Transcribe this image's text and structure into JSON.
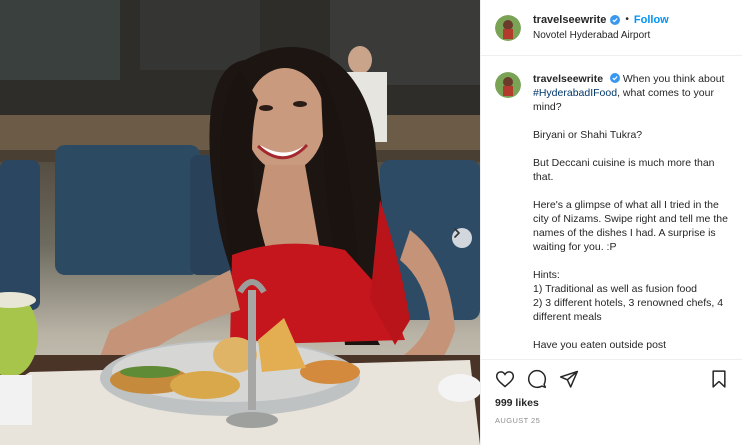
{
  "post": {
    "username": "travelseewrite",
    "follow_label": "Follow",
    "separator": "•",
    "location": "Novotel Hyderabad Airport",
    "caption_intro": "When you think about ",
    "hashtag": "#HyderabadIFood",
    "caption_intro_end": ", what comes to your mind?",
    "caption_lines": [
      "Biryani or Shahi Tukra?",
      "But Deccani cuisine is much more than that.",
      "Here's a glimpse of what all I tried in the city of Nizams. Swipe right and tell me the names of the dishes I had. A surprise is waiting for you. :P",
      "Hints:\n1) Traditional as well as fusion food\n2) 3 different hotels, 3 renowned chefs, 4 different meals",
      "Have you eaten outside post"
    ],
    "likes": "999 likes",
    "date": "AUGUST 25"
  },
  "icons": {
    "like": "heart-icon",
    "comment": "comment-icon",
    "share": "share-icon",
    "save": "bookmark-icon",
    "verified": "verified-badge-icon",
    "next": "chevron-right-icon"
  },
  "colors": {
    "accent": "#0095f6",
    "hashtag": "#00376b",
    "dress": "#c4161c",
    "muted": "#8e8e8e"
  }
}
